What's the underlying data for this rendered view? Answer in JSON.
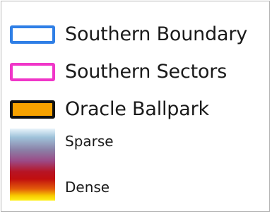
{
  "legend": {
    "items": [
      {
        "label": "Southern Boundary",
        "border_color": "#2f7fe6",
        "fill_color": "#ffffff"
      },
      {
        "label": "Southern Sectors",
        "border_color": "#f036c8",
        "fill_color": "#ffffff"
      },
      {
        "label": "Oracle Ballpark",
        "border_color": "#111111",
        "fill_color": "#f7a200"
      }
    ],
    "density_ramp": {
      "low_label": "Sparse",
      "high_label": "Dense",
      "colors": [
        "#e9f4fb",
        "#9fc3da",
        "#8b7fa6",
        "#9b4a86",
        "#b71424",
        "#c10f0f",
        "#e45d0a",
        "#f7c800",
        "#fff21a"
      ]
    }
  }
}
